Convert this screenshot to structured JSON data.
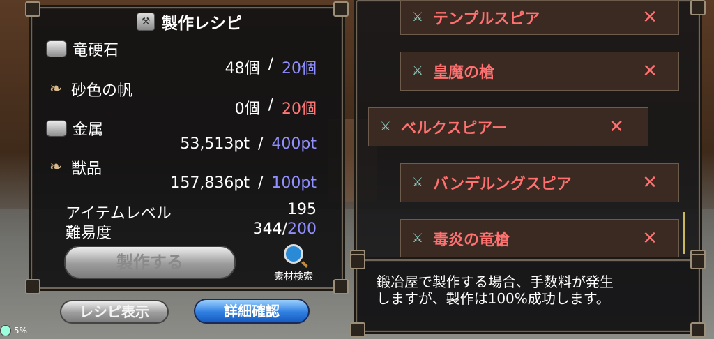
{
  "header": {
    "title": "製作レシピ"
  },
  "materials": [
    {
      "name": "竜硬石",
      "icon": "stone-icon",
      "have": "48個",
      "sep": "/",
      "need": "20個",
      "need_color": "blue"
    },
    {
      "name": "砂色の帆",
      "icon": "horn-icon",
      "have": "0個",
      "sep": "/",
      "need": "20個",
      "need_color": "red"
    },
    {
      "name": "金属",
      "icon": "stone-icon",
      "have": "53,513pt",
      "sep": "/",
      "need": "400pt",
      "need_color": "blue"
    },
    {
      "name": "獣品",
      "icon": "horn-icon",
      "have": "157,836pt",
      "sep": "/",
      "need": "100pt",
      "need_color": "blue"
    }
  ],
  "stats": {
    "item_level_label": "アイテムレベル",
    "item_level_value": "195",
    "difficulty_label": "難易度",
    "difficulty_value": "344/",
    "difficulty_max": "200"
  },
  "buttons": {
    "craft": "製作する",
    "search": "素材検索",
    "recipe_view": "レシピ表示",
    "detail": "詳細確認"
  },
  "recipes": [
    {
      "name": "テンプルスピア",
      "mark": "✕"
    },
    {
      "name": "皇魔の槍",
      "mark": "✕"
    },
    {
      "name": "ベルクスピアー",
      "mark": "✕"
    },
    {
      "name": "バンデルングスピア",
      "mark": "✕"
    },
    {
      "name": "毒炎の竜槍",
      "mark": "✕"
    }
  ],
  "message": {
    "line1": "鍛冶屋で製作する場合、手数料が発生",
    "line2": "しますが、製作は100%成功します。"
  },
  "status": {
    "percent": "5%"
  },
  "colors": {
    "blue": "#8f8fff",
    "red": "#ff7676",
    "recipe_text": "#ff7070"
  }
}
